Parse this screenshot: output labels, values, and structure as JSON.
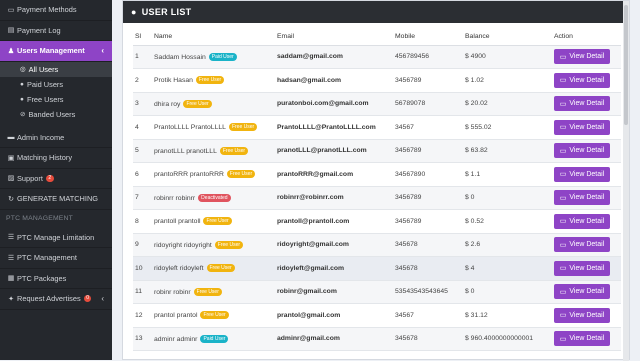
{
  "sidebar": {
    "top_items": [
      {
        "label": "Payment Methods",
        "icon": "card-icon"
      },
      {
        "label": "Payment Log",
        "icon": "document-icon"
      }
    ],
    "users": {
      "label": "Users Management",
      "icon": "users-icon"
    },
    "users_sub": [
      {
        "label": "All Users"
      },
      {
        "label": "Paid Users"
      },
      {
        "label": "Free Users"
      },
      {
        "label": "Banded Users"
      }
    ],
    "mid_items": [
      {
        "label": "Admin Income"
      },
      {
        "label": "Matching History"
      },
      {
        "label": "Support",
        "badge": "2"
      },
      {
        "label": "GENERATE MATCHING"
      }
    ],
    "section_header": "PTC MANAGEMENT",
    "ptc_items": [
      {
        "label": "PTC Manage Limitation"
      },
      {
        "label": "PTC Management"
      },
      {
        "label": "PTC Packages"
      },
      {
        "label": "Request Advertises",
        "badge": "0"
      }
    ]
  },
  "card": {
    "title": "USER LIST"
  },
  "table": {
    "headers": [
      "Sl",
      "Name",
      "Email",
      "Mobile",
      "Balance",
      "Action"
    ],
    "action_label": "View Detail",
    "rows": [
      {
        "sl": "1",
        "name": "Saddam Hossain",
        "status": "Paid User",
        "email": "saddam@gmail.com",
        "mobile": "456789456",
        "balance": "$ 4900"
      },
      {
        "sl": "2",
        "name": "Protik Hasan",
        "status": "Free User",
        "email": "hadsan@gmail.com",
        "mobile": "3456789",
        "balance": "$ 1.02"
      },
      {
        "sl": "3",
        "name": "dhira roy",
        "status": "Free User",
        "email": "puratonboi.com@gmail.com",
        "mobile": "56789078",
        "balance": "$ 20.02"
      },
      {
        "sl": "4",
        "name": "PrantoLLLL PrantoLLLL",
        "status": "Free User",
        "email": "PrantoLLLL@PrantoLLLL.com",
        "mobile": "34567",
        "balance": "$ 555.02"
      },
      {
        "sl": "5",
        "name": "pranotLLL pranotLLL",
        "status": "Free User",
        "email": "pranotLLL@pranotLLL.com",
        "mobile": "3456789",
        "balance": "$ 63.82"
      },
      {
        "sl": "6",
        "name": "prantoRRR prantoRRR",
        "status": "Free User",
        "email": "prantoRRR@gmail.com",
        "mobile": "34567890",
        "balance": "$ 1.1"
      },
      {
        "sl": "7",
        "name": "robinrr robinrr",
        "status": "Deactivated",
        "email": "robinrr@robinrr.com",
        "mobile": "3456789",
        "balance": "$ 0"
      },
      {
        "sl": "8",
        "name": "prantoll prantoll",
        "status": "Free User",
        "email": "prantoll@prantoll.com",
        "mobile": "3456789",
        "balance": "$ 0.52"
      },
      {
        "sl": "9",
        "name": "ridoyright ridoyright",
        "status": "Free User",
        "email": "ridoyright@gmail.com",
        "mobile": "345678",
        "balance": "$ 2.6"
      },
      {
        "sl": "10",
        "name": "ridoyleft ridoyleft",
        "status": "Free User",
        "email": "ridoyleft@gmail.com",
        "mobile": "345678",
        "balance": "$ 4"
      },
      {
        "sl": "11",
        "name": "robinr robinr",
        "status": "Free User",
        "email": "robinr@gmail.com",
        "mobile": "53543543543645",
        "balance": "$ 0"
      },
      {
        "sl": "12",
        "name": "prantol prantol",
        "status": "Free User",
        "email": "prantol@gmail.com",
        "mobile": "34567",
        "balance": "$ 31.12"
      },
      {
        "sl": "13",
        "name": "adminr adminr",
        "status": "Paid User",
        "email": "adminr@gmail.com",
        "mobile": "345678",
        "balance": "$ 960.4000000000001"
      }
    ]
  },
  "colors": {
    "accent": "#8e44c6",
    "paid": "#1ab3c8",
    "free": "#f1b40f",
    "deactivated": "#e0545f",
    "sidebar_bg": "#25282d"
  }
}
